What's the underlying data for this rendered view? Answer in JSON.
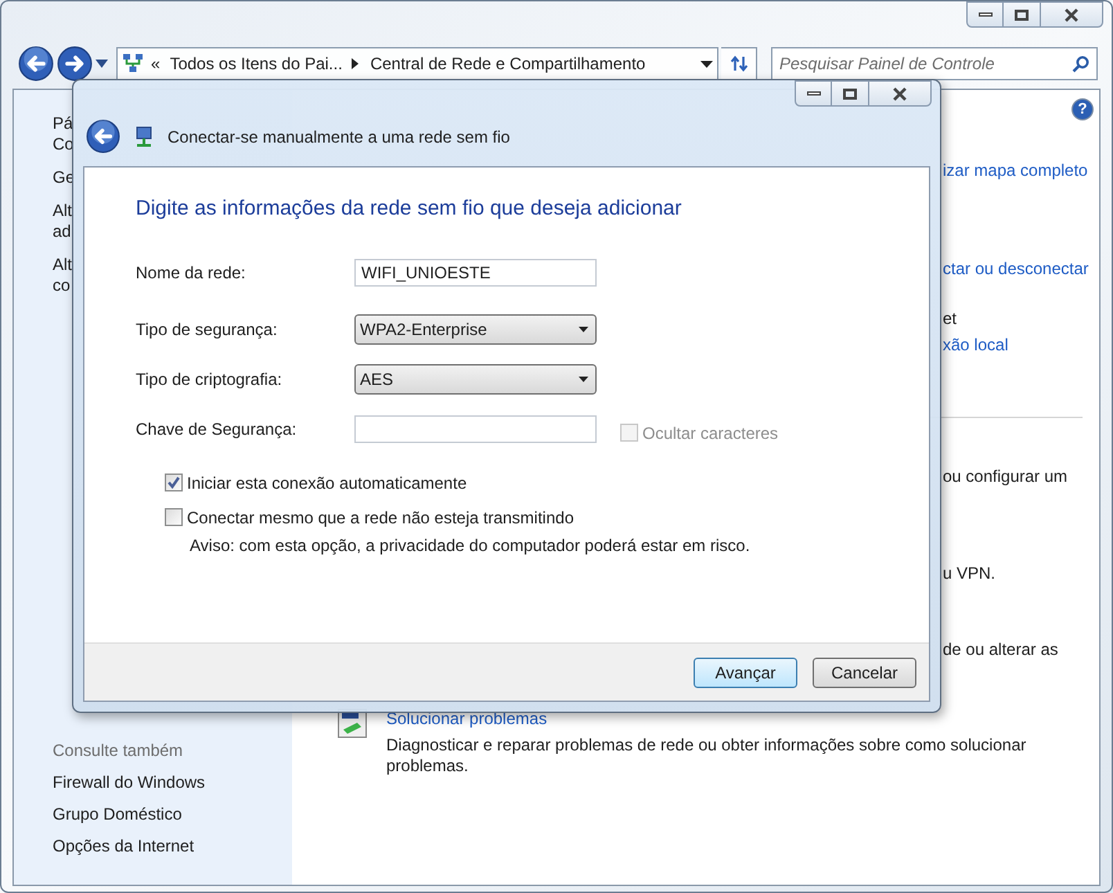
{
  "window": {
    "help_button": "?",
    "address": {
      "overflow": "«",
      "crumbs": [
        "Todos os Itens do Pai...",
        "Central de Rede e Compartilhamento"
      ]
    },
    "search": {
      "placeholder": "Pesquisar Painel de Controle"
    }
  },
  "sidebar": {
    "fragments": [
      [
        "Pá",
        "Co"
      ],
      [
        "Ge"
      ],
      [
        "Alt",
        "ad"
      ],
      [
        "Alt",
        "co"
      ]
    ],
    "see_also": {
      "title": "Consulte também",
      "links": [
        "Firewall do Windows",
        "Grupo Doméstico",
        "Opções da Internet"
      ]
    }
  },
  "main": {
    "fragments": [
      {
        "text": "izar mapa completo",
        "kind": "link"
      },
      {
        "text": "ctar ou desconectar",
        "kind": "link"
      },
      {
        "text": "et",
        "kind": "text"
      },
      {
        "text": "xão local",
        "kind": "link"
      },
      {
        "kind": "divider"
      },
      {
        "text": "ou configurar um",
        "kind": "text"
      },
      {
        "text": "u VPN.",
        "kind": "text"
      },
      {
        "text": "de ou alterar as",
        "kind": "text"
      }
    ],
    "troubleshoot": {
      "title": "Solucionar problemas",
      "description": "Diagnosticar e reparar problemas de rede ou obter informações sobre como solucionar problemas."
    }
  },
  "dialog": {
    "title": "Conectar-se manualmente a uma rede sem fio",
    "heading": "Digite as informações da rede sem fio que deseja adicionar",
    "fields": [
      {
        "label": "Nome da rede:",
        "kind": "text",
        "value": "WIFI_UNIOESTE"
      },
      {
        "label": "Tipo de segurança:",
        "kind": "select",
        "value": "WPA2-Enterprise"
      },
      {
        "label": "Tipo de criptografia:",
        "kind": "select",
        "value": "AES"
      },
      {
        "label": "Chave de Segurança:",
        "kind": "text",
        "option": {
          "label": "Ocultar caracteres",
          "checked": false,
          "disabled": true
        }
      }
    ],
    "options": [
      {
        "label": "Iniciar esta conexão automaticamente",
        "checked": true
      },
      {
        "label": "Conectar mesmo que a rede não esteja transmitindo",
        "checked": false
      }
    ],
    "warning": "Aviso: com esta opção, a privacidade do computador poderá estar em risco.",
    "buttons": [
      {
        "label": "Avançar",
        "default": true
      },
      {
        "label": "Cancelar",
        "default": false
      }
    ]
  }
}
